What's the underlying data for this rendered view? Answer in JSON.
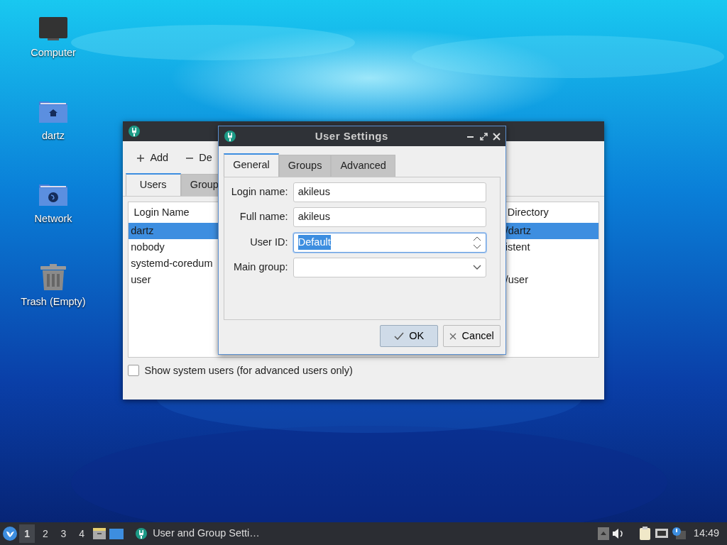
{
  "desktop_icons": [
    {
      "label": "Computer",
      "kind": "computer"
    },
    {
      "label": "dartz",
      "kind": "home"
    },
    {
      "label": "Network",
      "kind": "network"
    },
    {
      "label": "Trash (Empty)",
      "kind": "trash"
    }
  ],
  "main_window": {
    "toolbar": [
      {
        "label": "Add",
        "kind": "add"
      },
      {
        "label": "De",
        "kind": "remove"
      }
    ],
    "tabs": [
      {
        "label": "Users",
        "selected": true
      },
      {
        "label": "Group",
        "selected": false
      }
    ],
    "table": {
      "columns": [
        "Login Name",
        "Directory"
      ],
      "rows": [
        {
          "login_name": "dartz",
          "column_2": "/dartz",
          "selected": true
        },
        {
          "login_name": "nobody",
          "column_2": "istent",
          "selected": false
        },
        {
          "login_name": "systemd-coredum",
          "selected": false
        },
        {
          "login_name": "user",
          "column_2": "/user",
          "selected": false
        }
      ]
    },
    "show_system_users": {
      "label": "Show system users (for advanced users only)",
      "checked": false
    }
  },
  "dialog": {
    "title": "User Settings",
    "tabs": [
      {
        "label": "General",
        "selected": true
      },
      {
        "label": "Groups",
        "selected": false
      },
      {
        "label": "Advanced",
        "selected": false
      }
    ],
    "fields": [
      {
        "label": "Login name:",
        "value": "akileus",
        "kind": "text",
        "focused": false
      },
      {
        "label": "Full name:",
        "value": "akileus",
        "kind": "text",
        "focused": false
      },
      {
        "label": "User ID:",
        "value": "Default",
        "kind": "spin",
        "focused": true,
        "text_selected": true
      },
      {
        "label": "Main group:",
        "kind": "combo",
        "focused": false
      }
    ],
    "buttons": [
      {
        "label": "OK",
        "kind": "ok",
        "default": true
      },
      {
        "label": "Cancel",
        "kind": "cancel",
        "default": false
      }
    ]
  },
  "taskbar": {
    "workspaces": [
      {
        "label": "1",
        "selected": true
      },
      {
        "label": "2",
        "selected": false
      },
      {
        "label": "3",
        "selected": false
      },
      {
        "label": "4",
        "selected": false
      }
    ],
    "task": {
      "label": "User and Group Setti…"
    },
    "clock": "14:49"
  }
}
